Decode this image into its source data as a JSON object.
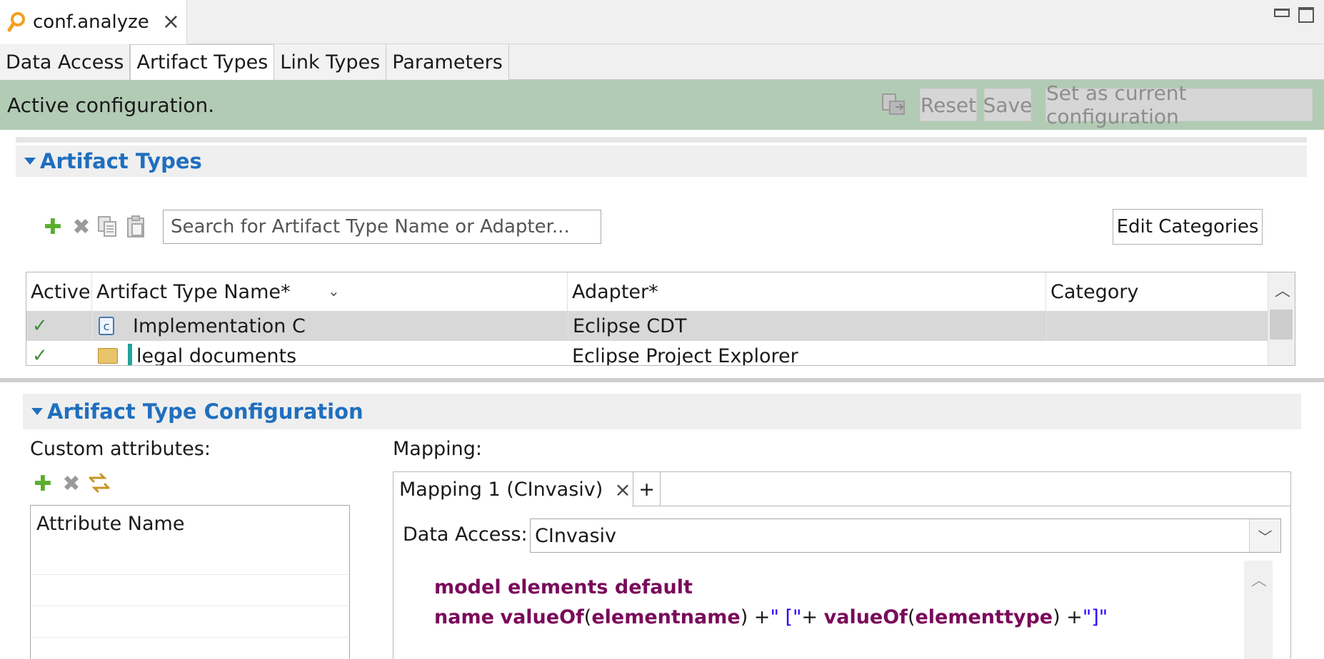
{
  "editor": {
    "tab_title": "conf.analyze",
    "close_glyph": "×"
  },
  "subtabs": [
    "Data Access",
    "Artifact Types",
    "Link Types",
    "Parameters"
  ],
  "status": {
    "text": "Active configuration.",
    "reset_label": "Reset",
    "save_label": "Save",
    "set_current_label": "Set as current configuration",
    "background_color": "#b2cbb4"
  },
  "artifact_types": {
    "section_title": "Artifact Types",
    "search_placeholder": "Search for Artifact Type Name or Adapter...",
    "edit_categories_label": "Edit Categories",
    "columns": [
      "Active",
      "Artifact Type Name*",
      "Adapter*",
      "Category"
    ],
    "rows": [
      {
        "active": "✓",
        "name": "Implementation C",
        "adapter": "Eclipse CDT",
        "category": "",
        "selected": true
      },
      {
        "active": "✓",
        "name": "legal documents",
        "adapter": "Eclipse Project Explorer",
        "category": "",
        "selected": false
      }
    ]
  },
  "configuration": {
    "section_title": "Artifact Type Configuration",
    "custom_attributes_label": "Custom attributes:",
    "attribute_column": "Attribute Name",
    "mapping_label": "Mapping:",
    "mapping_tab": "Mapping 1 (CInvasiv)",
    "add_tab": "+",
    "data_access_label": "Data Access:",
    "data_access_value": "CInvasiv",
    "code": {
      "line1": "model elements default",
      "line2_kw1": "name",
      "line2_kw2": "valueOf",
      "line2_p1": "(",
      "line2_kw3": "elementname",
      "line2_p2": ") +",
      "line2_str1": "\" [\"",
      "line2_p3": "+ ",
      "line2_kw4": "valueOf",
      "line2_p4": "(",
      "line2_kw5": "elementtype",
      "line2_p5": ") +",
      "line2_str2": "\"]\""
    }
  }
}
